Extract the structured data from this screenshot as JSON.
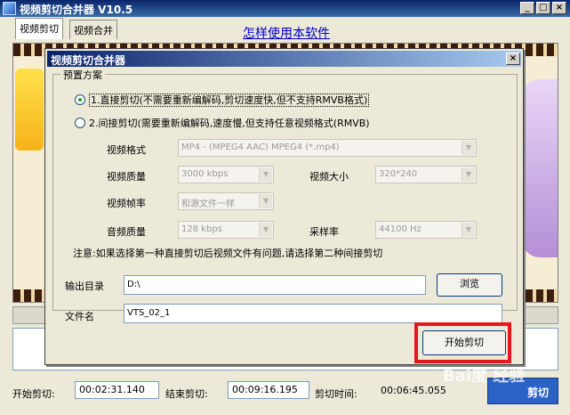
{
  "main_window": {
    "title": "视频剪切合并器  V10.5",
    "min_btn": "_",
    "max_btn": "□",
    "close_btn": "×"
  },
  "tabs": [
    {
      "label": "视频剪切",
      "active": true
    },
    {
      "label": "视频合并",
      "active": false
    }
  ],
  "header_link": "怎样使用本软件",
  "bottom_bar": {
    "start_label": "开始剪切:",
    "start_value": "00:02:31.140",
    "end_label": "结束剪切:",
    "end_value": "00:09:16.195",
    "duration_label": "剪切时间:",
    "duration_value": "00:06:45.055",
    "main_button": "剪切"
  },
  "dialog": {
    "title": "视频剪切合并器",
    "close": "×",
    "preset_group": "预置方案",
    "option1": "1.直接剪切(不需要重新编解码,剪切速度快,但不支持RMVB格式)",
    "option2": "2.间接剪切(需要重新编解码,速度慢,但支持任意视频格式(RMVB)",
    "selected_option": 1,
    "fields": {
      "format_label": "视频格式",
      "format_value": "MP4 - (MPEG4 AAC) MPEG4 (*.mp4)",
      "quality_label": "视频质量",
      "quality_value": "3000 kbps",
      "size_label": "视频大小",
      "size_value": "320*240",
      "fps_label": "视频帧率",
      "fps_value": "和源文件一样",
      "audio_label": "音频质量",
      "audio_value": "128 kbps",
      "sample_label": "采样率",
      "sample_value": "44100 Hz"
    },
    "note": "注意:如果选择第一种直接剪切后视频文件有问题,请选择第二种间接剪切",
    "output_dir_label": "输出目录",
    "output_dir_value": "D:\\",
    "browse_button": "浏览",
    "filename_label": "文件名",
    "filename_value": "VTS_02_1",
    "start_button": "开始剪切"
  },
  "watermark": "Bai度 经验",
  "colors": {
    "highlight": "#e8161d",
    "titlebar": "#0a246a",
    "link": "#0000cc"
  }
}
